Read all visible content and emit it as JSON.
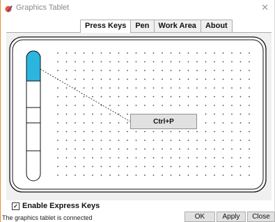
{
  "window": {
    "title": "Graphics Tablet"
  },
  "tabs": [
    {
      "label": "Press Keys",
      "active": true
    },
    {
      "label": "Pen",
      "active": false
    },
    {
      "label": "Work Area",
      "active": false
    },
    {
      "label": "About",
      "active": false
    }
  ],
  "tablet": {
    "key_slots": 5,
    "selected_slot": 1,
    "mapped_key": "Ctrl+P",
    "accent_color": "#2bb5df"
  },
  "options": {
    "express_keys_label": "Enable Express Keys",
    "express_keys_checked": true
  },
  "status": {
    "text": "The graphics tablet is connected"
  },
  "buttons": {
    "ok": "OK",
    "apply": "Apply",
    "close": "Close"
  }
}
